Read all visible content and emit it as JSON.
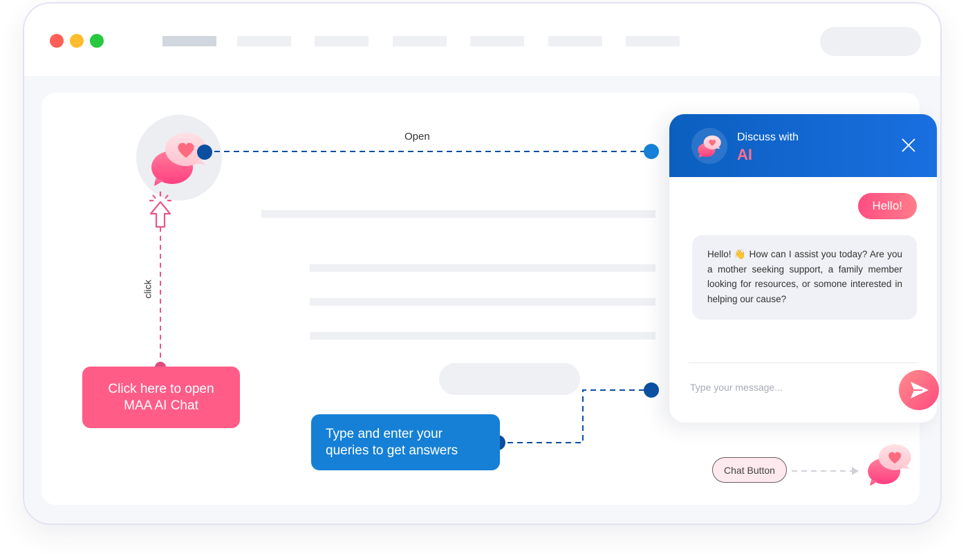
{
  "browser": {
    "traffic_lights": {
      "close": "#ff5f57",
      "minimize": "#febc2e",
      "maximize": "#28c840"
    },
    "nav_placeholders": 7
  },
  "annotations": {
    "open_label": "Open",
    "click_label": "click",
    "open_callout": "Click here to open MAA AI Chat",
    "open_callout_line1": "Click here to open",
    "open_callout_line2": "MAA AI Chat",
    "type_callout_line1": "Type and enter your",
    "type_callout_line2": "queries to get answers",
    "chat_button_label": "Chat Button"
  },
  "chat": {
    "title_line1": "Discuss with",
    "title_line2": "AI",
    "close_icon": "close-icon",
    "messages": [
      {
        "from": "user",
        "text": "Hello!"
      },
      {
        "from": "bot",
        "text_before_emoji": "Hello! ",
        "emoji": "👋",
        "text_after_emoji": " How can I assist you today? Are you a mother seeking support, a family member looking for resources, or somone interested in helping our cause?"
      }
    ],
    "input_placeholder": "Type your message...",
    "send_icon": "send-icon"
  },
  "colors": {
    "brand_blue": "#0b5fbf",
    "accent_pink": "#ff5c88",
    "callout_blue": "#1580d6",
    "connector_blue": "#0a4fa0",
    "connector_pink": "#e8578a"
  }
}
